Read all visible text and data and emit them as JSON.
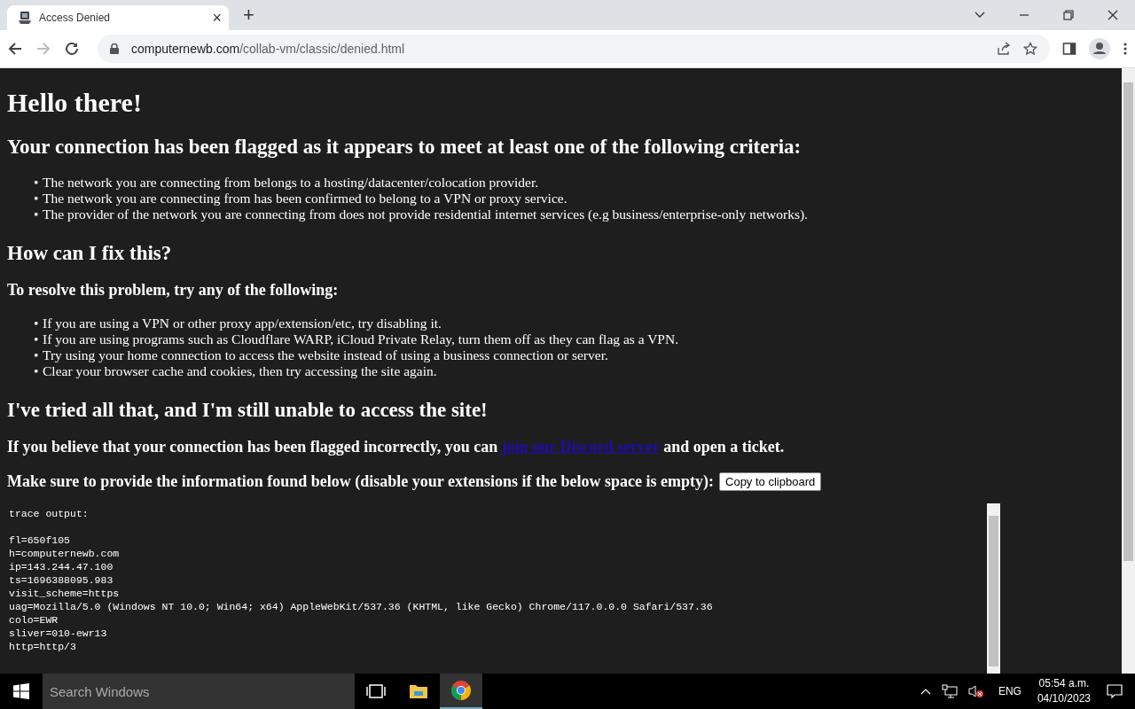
{
  "tab": {
    "title": "Access Denied",
    "close": "×",
    "new_tab": "+"
  },
  "address": {
    "domain": "computernewb.com",
    "path": "/collab-vm/classic/denied.html"
  },
  "page": {
    "title": "Hello there!",
    "criteria_heading": "Your connection has been flagged as it appears to meet at least one of the following criteria:",
    "criteria": [
      {
        "bullet": "•",
        "text": "The network you are connecting from belongs to a hosting/datacenter/colocation provider."
      },
      {
        "bullet": "•",
        "text": "The network you are connecting from has been confirmed to belong to a VPN or proxy service."
      },
      {
        "bullet": "•",
        "text": "The provider of the network you are connecting from does not provide residential internet services (e.g business/enterprise-only networks)."
      }
    ],
    "fix_heading": "How can I fix this?",
    "fix_subheading": "To resolve this problem, try any of the following:",
    "fixes": [
      {
        "bullet": "•",
        "text": "If you are using a VPN or other proxy app/extension/etc, try disabling it."
      },
      {
        "bullet": "•",
        "text": "If you are using programs such as Cloudflare WARP, iCloud Private Relay, turn them off as they can flag as a VPN."
      },
      {
        "bullet": "•",
        "text": "Try using your home connection to access the website instead of using a business connection or server."
      },
      {
        "bullet": "•",
        "text": "Clear your browser cache and cookies, then try accessing the site again."
      }
    ],
    "tried_heading": "I've tried all that, and I'm still unable to access the site!",
    "ticket_before": "If you believe that your connection has been flagged incorrectly, you can",
    "ticket_link": "join our Discord server",
    "ticket_after": "and open a ticket.",
    "provide_text": "Make sure to provide the information found below (disable your extensions if the below space is empty):",
    "copy_button": "Copy to clipboard",
    "trace_header": "trace output:",
    "trace_lines": [
      "fl=650f105",
      "h=computernewb.com",
      "ip=143.244.47.100",
      "ts=1696388095.983",
      "visit_scheme=https",
      "uag=Mozilla/5.0 (Windows NT 10.0; Win64; x64) AppleWebKit/537.36 (KHTML, like Gecko) Chrome/117.0.0.0 Safari/537.36",
      "colo=EWR",
      "sliver=010-ewr13",
      "http=http/3"
    ]
  },
  "taskbar": {
    "search_placeholder": "Search Windows",
    "language": "ENG",
    "time": "05:54 a.m.",
    "date": "04/10/2023"
  }
}
